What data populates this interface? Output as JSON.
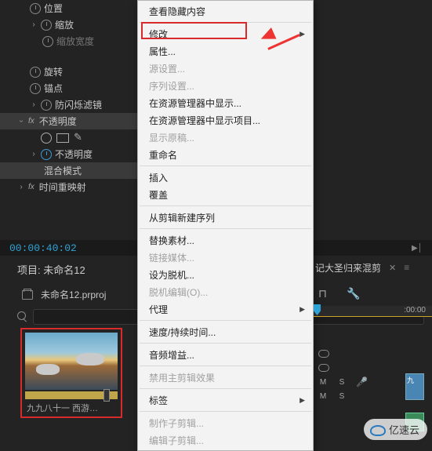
{
  "effects": {
    "position": "位置",
    "scale": "缩放",
    "scale_width": "缩放宽度",
    "rotation": "旋转",
    "anchor": "锚点",
    "anti_flicker": "防闪烁滤镜",
    "opacity_group": "不透明度",
    "opacity": "不透明度",
    "blend_mode": "混合模式",
    "time_remap": "时间重映射",
    "fx": "fx"
  },
  "timecode": "00:00:40:02",
  "play_ind": "▶│",
  "project": {
    "title": "项目: 未命名12",
    "file": "未命名12.prproj",
    "thumb_label": "九九八十一 西游…"
  },
  "menu": {
    "view_hidden": "查看隐藏内容",
    "modify": "修改",
    "properties": "属性...",
    "source_settings": "源设置...",
    "sequence_settings": "序列设置...",
    "reveal_explorer": "在资源管理器中显示...",
    "reveal_project_explorer": "在资源管理器中显示项目...",
    "show_original": "显示原稿...",
    "rename": "重命名",
    "insert": "插入",
    "overwrite": "覆盖",
    "new_seq_from_clip": "从剪辑新建序列",
    "replace_footage": "替换素材...",
    "link_media": "链接媒体...",
    "make_offline": "设为脱机...",
    "offline_edit": "脱机编辑(O)...",
    "proxy": "代理",
    "speed_duration": "速度/持续时间...",
    "audio_gain": "音频增益...",
    "disable_master_fx": "禁用主剪辑效果",
    "label": "标签",
    "make_subclip": "制作子剪辑...",
    "edit_subclip": "编辑子剪辑..."
  },
  "timeline": {
    "tab": "记大圣归来混剪",
    "ruler": ":00:00",
    "M": "M",
    "S": "S",
    "nine": "九"
  },
  "watermark": "亿速云"
}
